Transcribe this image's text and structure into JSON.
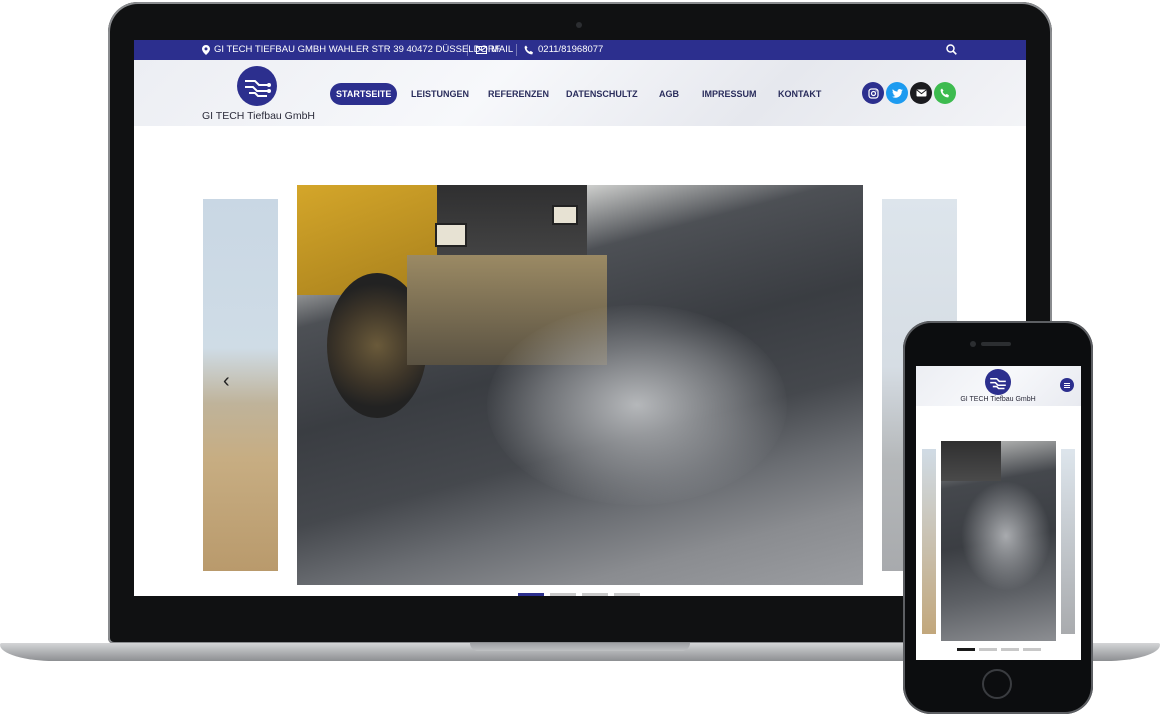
{
  "topbar": {
    "address": "GI TECH TIEFBAU GMBH WAHLER STR 39 40472 DÜSSELDORF",
    "mail": "MAIL",
    "phone": "0211/81968077"
  },
  "brand": {
    "name": "GI TECH Tiefbau GmbH"
  },
  "nav": {
    "items": [
      "STARTSEITE",
      "LEISTUNGEN",
      "REFERENZEN",
      "DATENSCHULTZ",
      "AGB",
      "IMPRESSUM",
      "KONTAKT"
    ],
    "active": "STARTSEITE"
  },
  "social": [
    "instagram-icon",
    "twitter-icon",
    "mail-icon",
    "phone-icon"
  ],
  "colors": {
    "brand_blue": "#2c2f8e",
    "twitter": "#1d9bf0",
    "whatsapp": "#3dbb4f",
    "dark": "#1b1b1f"
  },
  "slider": {
    "prev_glyph": "‹",
    "dot_count": 4,
    "active_dot": 1
  },
  "mobile": {
    "brand_name": "GI TECH Tiefbau GmbH",
    "dot_count": 4,
    "active_dot": 1
  }
}
